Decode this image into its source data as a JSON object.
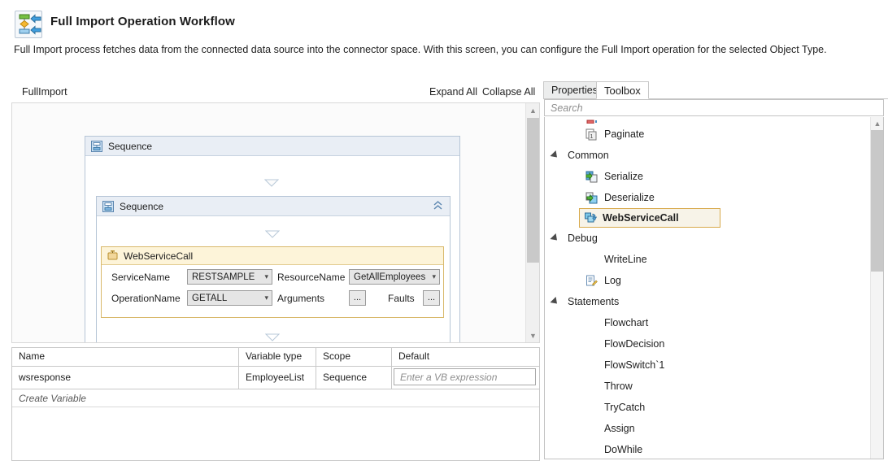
{
  "header": {
    "icon": "workflow-import-icon",
    "title": "Full Import Operation Workflow",
    "description": "Full Import process fetches data from the connected data source into the connector space. With this screen, you can configure the Full Import operation for the selected Object Type."
  },
  "designer": {
    "breadcrumb": "FullImport",
    "expand_all": "Expand All",
    "collapse_all": "Collapse All",
    "outer_sequence": {
      "label": "Sequence",
      "icon": "sequence-icon"
    },
    "inner_sequence": {
      "label": "Sequence",
      "icon": "sequence-icon",
      "collapse_icon": "chevron-up-icon"
    },
    "activity": {
      "title": "WebServiceCall",
      "icon": "webservicecall-activity-icon",
      "fields": [
        {
          "label": "ServiceName",
          "value": "RESTSAMPLE",
          "type": "combobox"
        },
        {
          "label": "ResourceName",
          "value": "GetAllEmployees",
          "type": "combobox"
        },
        {
          "label": "OperationName",
          "value": "GETALL",
          "type": "combobox"
        },
        {
          "label": "Arguments",
          "value": "...",
          "type": "button"
        },
        {
          "label": "Faults",
          "value": "...",
          "type": "button"
        }
      ]
    }
  },
  "variables": {
    "columns": [
      "Name",
      "Variable type",
      "Scope",
      "Default"
    ],
    "rows": [
      {
        "name": "wsresponse",
        "type": "EmployeeList",
        "scope": "Sequence",
        "default_placeholder": "Enter a VB expression"
      }
    ],
    "create_row_label": "Create Variable"
  },
  "right_panel": {
    "tabs": [
      {
        "label": "Properties",
        "active": false
      },
      {
        "label": "Toolbox",
        "active": true
      }
    ],
    "search_placeholder": "Search",
    "tree": [
      {
        "label": "Paginate",
        "kind": "leaf",
        "icon": "paginate-icon",
        "selected": false
      },
      {
        "label": "Common",
        "kind": "group",
        "icon": "expander-icon",
        "selected": false
      },
      {
        "label": "Serialize",
        "kind": "leaf",
        "icon": "serialize-icon",
        "selected": false
      },
      {
        "label": "Deserialize",
        "kind": "leaf",
        "icon": "deserialize-icon",
        "selected": false
      },
      {
        "label": "WebServiceCall",
        "kind": "leaf",
        "icon": "webservicecall-icon",
        "selected": true
      },
      {
        "label": "Debug",
        "kind": "group",
        "icon": "expander-icon",
        "selected": false
      },
      {
        "label": "WriteLine",
        "kind": "leaf-noicon",
        "icon": "",
        "selected": false
      },
      {
        "label": "Log",
        "kind": "leaf",
        "icon": "log-icon",
        "selected": false
      },
      {
        "label": "Statements",
        "kind": "group",
        "icon": "expander-icon",
        "selected": false
      },
      {
        "label": "Flowchart",
        "kind": "leaf-noicon",
        "icon": "",
        "selected": false
      },
      {
        "label": "FlowDecision",
        "kind": "leaf-noicon",
        "icon": "",
        "selected": false
      },
      {
        "label": "FlowSwitch`1",
        "kind": "leaf-noicon",
        "icon": "",
        "selected": false
      },
      {
        "label": "Throw",
        "kind": "leaf-noicon",
        "icon": "",
        "selected": false
      },
      {
        "label": "TryCatch",
        "kind": "leaf-noicon",
        "icon": "",
        "selected": false
      },
      {
        "label": "Assign",
        "kind": "leaf-noicon",
        "icon": "",
        "selected": false
      },
      {
        "label": "DoWhile",
        "kind": "leaf-noicon",
        "icon": "",
        "selected": false
      }
    ]
  },
  "colors": {
    "activity_accent": "#d9b96b",
    "selection_border": "#d8a94b",
    "sequence_border": "#b6c5d6",
    "sequence_header": "#e9eef5"
  }
}
